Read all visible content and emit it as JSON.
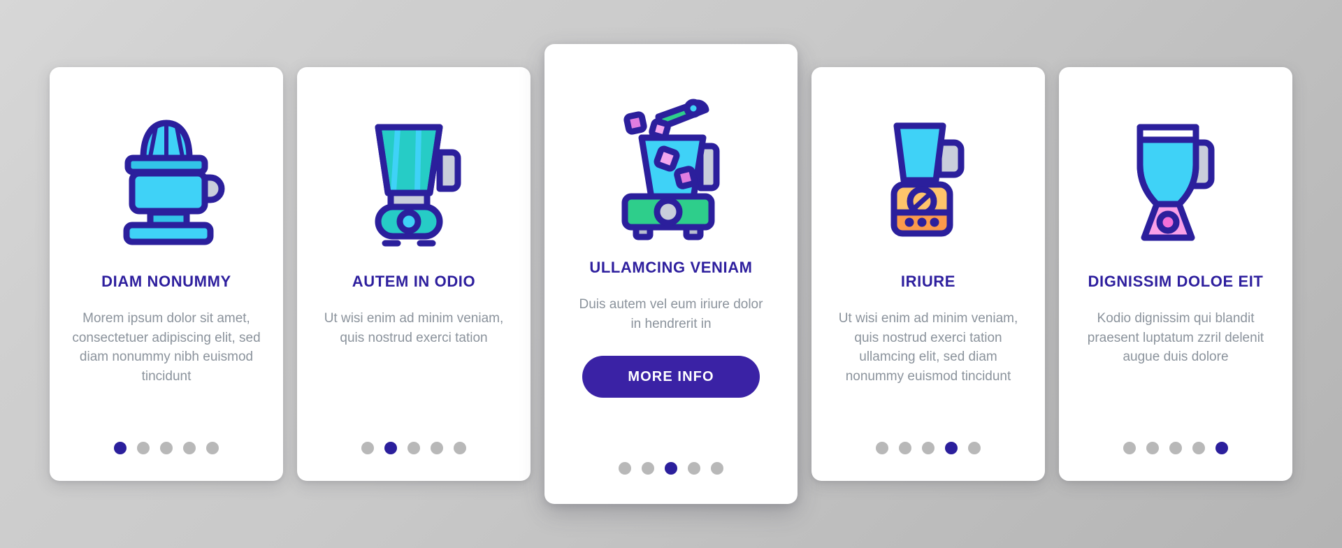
{
  "theme": {
    "accent": "#2e1f9e",
    "button_bg": "#3a22a5",
    "body_text": "#8b939c",
    "dot_inactive": "#b8b8b8",
    "dot_active": "#2b1f9c",
    "card_bg": "#ffffff",
    "background": "#c9c9c9",
    "outline": "#2b1f9c",
    "cyan": "#3fd2f7",
    "teal": "#26ccc6",
    "green": "#2ece8b",
    "pink": "#f9a0e8",
    "violet": "#e07de0",
    "orange_light": "#ffc46b",
    "orange": "#fb9a4b",
    "gray_part": "#c9cedb"
  },
  "cards": [
    {
      "title": "DIAM NONUMMY",
      "body": "Morem ipsum dolor sit amet, consectetuer adipiscing elit, sed diam nonummy nibh euismod tincidunt",
      "icon": "citrus-juicer-icon",
      "featured": false,
      "dots": {
        "count": 5,
        "active": 0
      }
    },
    {
      "title": "AUTEM IN ODIO",
      "body": "Ut wisi enim ad minim veniam, quis nostrud exerci tation",
      "icon": "striped-blender-icon",
      "featured": false,
      "dots": {
        "count": 5,
        "active": 1
      }
    },
    {
      "title": "ULLAMCING VENIAM",
      "body": "Duis autem vel eum iriure dolor in hendrerit in",
      "icon": "ice-blender-icon",
      "featured": true,
      "cta_label": "MORE INFO",
      "dots": {
        "count": 5,
        "active": 2
      }
    },
    {
      "title": "IRIURE",
      "body": "Ut wisi enim ad minim veniam, quis nostrud exerci tation ullamcing elit, sed diam nonummy euismod tincidunt",
      "icon": "dial-blender-icon",
      "featured": false,
      "dots": {
        "count": 5,
        "active": 3
      }
    },
    {
      "title": "DIGNISSIM DOLOE EIT",
      "body": "Kodio dignissim qui blandit praesent luptatum zzril delenit augue duis dolore",
      "icon": "pink-base-blender-icon",
      "featured": false,
      "dots": {
        "count": 5,
        "active": 4
      }
    }
  ]
}
